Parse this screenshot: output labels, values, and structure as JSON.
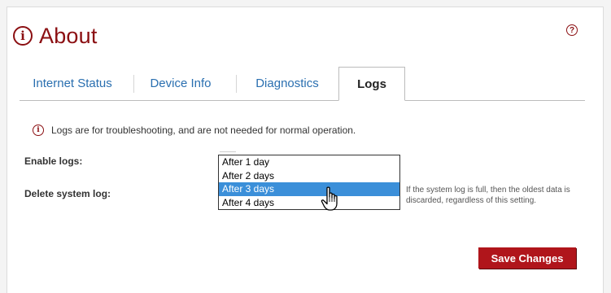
{
  "header": {
    "title": "About",
    "info_glyph": "i",
    "help_glyph": "?"
  },
  "tabs": [
    {
      "label": "Internet Status",
      "active": false
    },
    {
      "label": "Device Info",
      "active": false
    },
    {
      "label": "Diagnostics",
      "active": false
    },
    {
      "label": "Logs",
      "active": true
    }
  ],
  "info_message": "Logs are for troubleshooting, and are not needed for normal operation.",
  "form": {
    "enable_logs_label": "Enable logs:",
    "delete_log_label": "Delete system log:",
    "delete_options": [
      "After 1 day",
      "After 2 days",
      "After 3 days",
      "After 4 days"
    ],
    "selected_option": "After 3 days",
    "note": "If the system log is full, then the oldest data is discarded, regardless of this setting."
  },
  "actions": {
    "save_label": "Save Changes"
  },
  "colors": {
    "brand": "#8b0f12",
    "tab_link": "#2a6fb0",
    "button": "#b0151b",
    "highlight": "#3b8fd9"
  },
  "icons": [
    "info-icon",
    "help-icon",
    "hand-pointer-cursor-icon"
  ]
}
